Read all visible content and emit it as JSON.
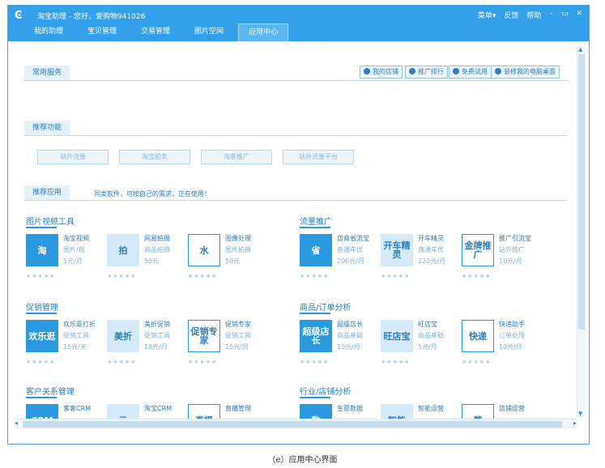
{
  "titlebar": {
    "logo_glyph": "Ͼ",
    "app_title": "淘宝助理 - 您好，爱购物941026",
    "menu": "菜单▾",
    "feedback": "反馈",
    "help": "帮助",
    "minimize": "–",
    "maximize": "▭",
    "close": "✕"
  },
  "nav": {
    "tabs": [
      "我的助理",
      "宝贝管理",
      "交易管理",
      "图片空间",
      "应用中心"
    ],
    "active": "应用中心"
  },
  "common_services": {
    "title": "常用服务",
    "buttons": [
      "我的店铺",
      "推广排行",
      "免费试用",
      "装修我的电脑桌面"
    ]
  },
  "recommended_features": {
    "title": "推荐功能",
    "buttons": [
      "站外流量",
      "淘宝拍卖",
      "淘客推广",
      "站外流量平台"
    ]
  },
  "recommended_apps": {
    "title": "推荐应用",
    "note": "同类软件，可按自己的需求，正在使用！"
  },
  "categories": [
    {
      "title": "图片视频工具",
      "apps": [
        {
          "icon": "淘",
          "name": "淘宝视频",
          "desc": "图片/视",
          "price": "5元/月"
        },
        {
          "icon": "拍",
          "name": "网易拍摄",
          "desc": "商品拍摄",
          "price": "50元"
        },
        {
          "icon": "水",
          "name": "图像处理",
          "desc": "图片拍摄",
          "price": "50元"
        }
      ]
    },
    {
      "title": "流量推广",
      "apps": [
        {
          "icon": "省",
          "name": "店商省流宝",
          "desc": "直通车优",
          "price": "200元/月"
        },
        {
          "icon": "开车精灵",
          "name": "开车精灵",
          "desc": "直通车优",
          "price": "220元/月"
        },
        {
          "icon": "金牌推广",
          "name": "推广引流宝",
          "desc": "站外推广",
          "price": "10元/月"
        }
      ]
    },
    {
      "title": "促销管理",
      "apps": [
        {
          "icon": "欢乐逛",
          "name": "欢乐逛打折",
          "desc": "促销工具",
          "price": "15元/天"
        },
        {
          "icon": "美折",
          "name": "美折促销",
          "desc": "促销工具",
          "price": "18元/月"
        },
        {
          "icon": "促销专家",
          "name": "促销专家",
          "desc": "促销工具",
          "price": "15元/月"
        }
      ]
    },
    {
      "title": "商品/订单分析",
      "apps": [
        {
          "icon": "超级店长",
          "name": "超级店长",
          "desc": "商品基础",
          "price": "15元/月"
        },
        {
          "icon": "旺店宝",
          "name": "旺店宝",
          "desc": "商品基础",
          "price": "5元/月"
        },
        {
          "icon": "快递",
          "name": "快递助手",
          "desc": "订单处理",
          "price": "10元/月"
        }
      ]
    },
    {
      "title": "客户关系管理",
      "apps": [
        {
          "icon": "CRM",
          "name": "客客CRM",
          "desc": "",
          "price": ""
        },
        {
          "icon": "云",
          "name": "淘宝CRM",
          "desc": "",
          "price": ""
        },
        {
          "icon": "直播",
          "name": "直播管理",
          "desc": "",
          "price": ""
        }
      ]
    },
    {
      "title": "行业/店铺分析",
      "apps": [
        {
          "icon": "数",
          "name": "生意数据",
          "desc": "",
          "price": ""
        },
        {
          "icon": "智能",
          "name": "智能运营",
          "desc": "",
          "price": ""
        },
        {
          "icon": "营",
          "name": "店铺运营",
          "desc": "",
          "price": ""
        }
      ]
    }
  ],
  "stars": "★★★★★",
  "caption": "（e）应用中心界面",
  "colors": {
    "accent": "#32a0ea",
    "text": "#2a7fc0"
  }
}
